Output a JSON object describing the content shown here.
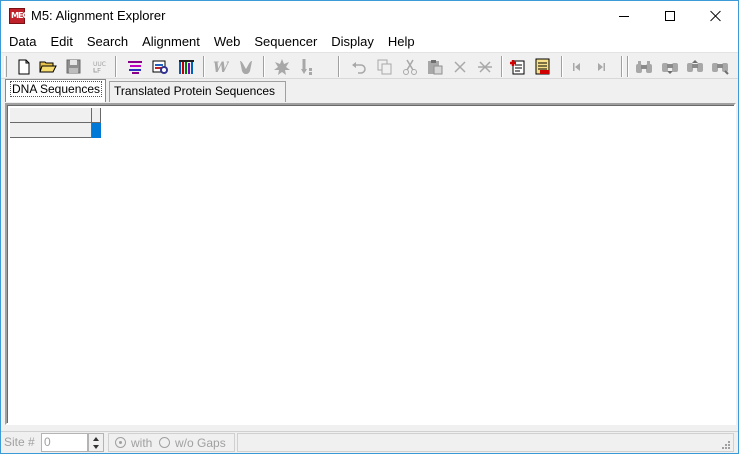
{
  "window": {
    "title": "M5: Alignment Explorer",
    "app_icon_text": "MEGA"
  },
  "menu": [
    "Data",
    "Edit",
    "Search",
    "Alignment",
    "Web",
    "Sequencer",
    "Display",
    "Help"
  ],
  "toolbar": {
    "icons": [
      "new-file-icon",
      "open-folder-icon",
      "save-icon",
      "translate-icon",
      "align-by-clustalw-icon",
      "align-by-muscle-icon",
      "codon-align-icon",
      "w-clustal-icon",
      "muscle-icon",
      "mark-site-icon",
      "insert-gap-icon",
      "undo-icon",
      "copy-icon",
      "cut-icon",
      "paste-icon",
      "delete-icon",
      "delete-gap-icon",
      "add-sequence-icon",
      "edit-sequence-icon",
      "previous-site-icon",
      "next-site-icon",
      "find-icon",
      "find-next-icon",
      "find-previous-icon",
      "find-marked-icon"
    ]
  },
  "tabs": [
    {
      "label": "DNA Sequences",
      "active": true
    },
    {
      "label": "Translated Protein Sequences",
      "active": false
    }
  ],
  "statusbar": {
    "site_label": "Site #",
    "site_value": "0",
    "with_label": "with",
    "without_label": "w/o Gaps"
  },
  "colors": {
    "window_border": "#3c9bd6",
    "selection": "#0078d7",
    "disabled_text": "#a0a0a0"
  }
}
